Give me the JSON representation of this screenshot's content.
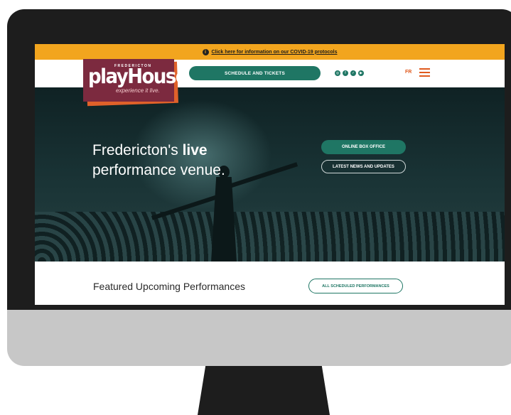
{
  "covid_bar": {
    "link_text": "Click here for information on our COVID-19 protocols"
  },
  "logo": {
    "city": "FREDERICTON",
    "name": "playHouse",
    "tagline": "experience it live."
  },
  "nav": {
    "schedule_label": "SCHEDULE AND TICKETS",
    "socials": [
      "instagram-icon",
      "facebook-icon",
      "twitter-icon",
      "youtube-icon"
    ],
    "lang_label": "FR"
  },
  "hero": {
    "line1_prefix": "Fredericton's ",
    "line1_bold": "live",
    "line2": "performance venue.",
    "box_office_label": "ONLINE BOX OFFICE",
    "news_label": "LATEST NEWS AND UPDATES"
  },
  "featured": {
    "title": "Featured Upcoming Performances",
    "all_label": "ALL SCHEDULED PERFORMANCES"
  },
  "colors": {
    "accent": "#1f7664",
    "banner": "#f2a51e",
    "logo": "#7c2a3f",
    "orange": "#e05a1e"
  }
}
